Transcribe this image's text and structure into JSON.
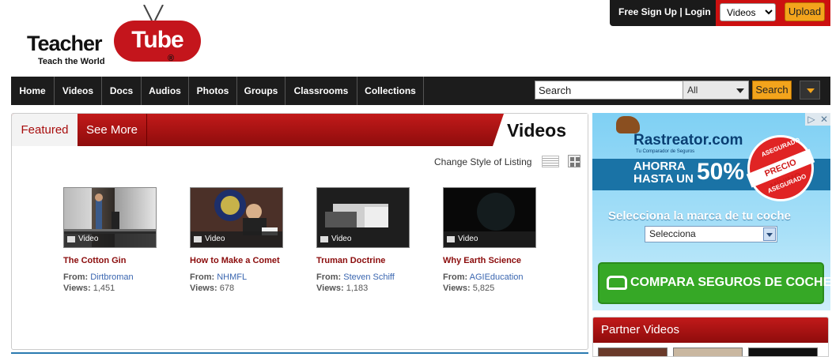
{
  "logo": {
    "teacher": "Teacher",
    "tube": "Tube",
    "tagline": "Teach the World",
    "reg": "®"
  },
  "topbar": {
    "signup": "Free Sign Up | Login",
    "type_select": "Videos",
    "upload": "Upload"
  },
  "nav": {
    "items": [
      "Home",
      "Videos",
      "Docs",
      "Audios",
      "Photos",
      "Groups",
      "Classrooms",
      "Collections"
    ],
    "search_placeholder": "Search",
    "scope": "All",
    "search_button": "Search"
  },
  "featured": {
    "tab_featured": "Featured",
    "tab_more": "See More",
    "section_title": "Videos",
    "change_style": "Change Style of Listing",
    "from_label": "From:",
    "views_label": "Views:",
    "videos": [
      {
        "badge": "Video",
        "title": "The Cotton Gin",
        "from": "Dirtbroman",
        "views": "1,451"
      },
      {
        "badge": "Video",
        "title": "How to Make a Comet",
        "from": "NHMFL",
        "views": "678"
      },
      {
        "badge": "Video",
        "title": "Truman Doctrine",
        "from": "Steven Schiff",
        "views": "1,183"
      },
      {
        "badge": "Video",
        "title": "Why Earth Science",
        "from": "AGIEducation",
        "views": "5,825"
      }
    ]
  },
  "ad": {
    "brand": "Rastreator.com",
    "brand_sub": "Tu Comparador de Seguros",
    "ahorra": "AHORRA",
    "hasta": "HASTA UN",
    "percent": "50%",
    "seal_top": "ASEGURADO",
    "seal_mid": "PRECIO MÍNIMO",
    "seal_bottom": "ASEGURADO",
    "question": "Selecciona la marca de tu coche",
    "select_value": "Selecciona",
    "cta": "COMPARA SEGUROS DE COCHE"
  },
  "partner": {
    "title": "Partner Videos"
  },
  "colors": {
    "brand_red": "#c4151c",
    "accent_orange": "#f3a41c",
    "nav_black": "#1c1c1c",
    "link_blue": "#3a66b0"
  }
}
